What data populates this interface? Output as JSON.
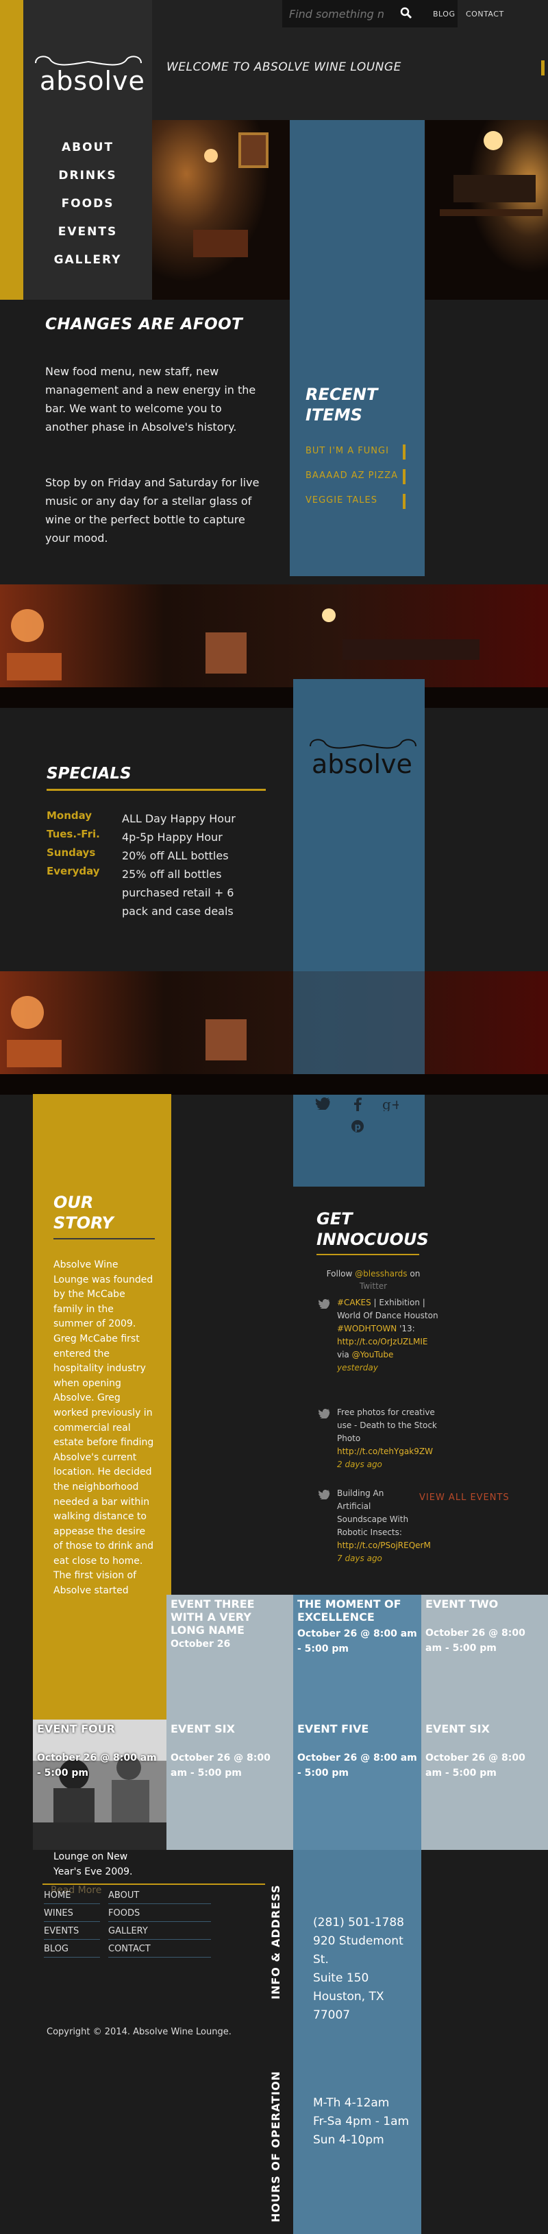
{
  "colors": {
    "gold": "#c49a14",
    "blue": "#3d6682",
    "dark": "#1c1c1c"
  },
  "header": {
    "search_placeholder": "Find something n",
    "search_icon": "search-icon",
    "blog_label": "BLOG",
    "contact_label": "CONTACT",
    "welcome": "WELCOME TO ABSOLVE WINE LOUNGE",
    "logo_text": "absolve"
  },
  "nav": {
    "items": [
      "ABOUT",
      "DRINKS",
      "FOODS",
      "EVENTS",
      "GALLERY"
    ]
  },
  "changes": {
    "title": "CHANGES ARE AFOOT",
    "p1": "New food menu, new staff, new management and a new energy in the bar. We want to welcome you to another phase in Absolve's history.",
    "p2": "Stop by on Friday and Saturday for live music or any day for a stellar glass of wine or the perfect bottle to capture your mood."
  },
  "recent": {
    "title_line1": "RECENT",
    "title_line2": "ITEMS",
    "items": [
      "BUT I'M A FUNGI",
      "BAAAAD AZ PIZZA",
      "VEGGIE TALES"
    ]
  },
  "specials": {
    "title": "SPECIALS",
    "rows": [
      {
        "day": "Monday",
        "deal": "ALL Day Happy Hour"
      },
      {
        "day": "Tues.-Fri.",
        "deal": "4p-5p Happy Hour"
      },
      {
        "day": "Sundays",
        "deal": "20% off ALL bottles"
      },
      {
        "day": "Everyday",
        "deal": "25% off all bottles purchased retail + 6 pack and case deals"
      }
    ]
  },
  "badge_logo": "absolve",
  "social": {
    "twitter_icon": "twitter-icon",
    "facebook_icon": "facebook-icon",
    "gplus_icon": "google-plus-icon",
    "pinterest_icon": "pinterest-icon"
  },
  "story": {
    "title_line1": "OUR",
    "title_line2": "STORY",
    "text": "Absolve Wine Lounge was founded by the McCabe family in the summer of 2009. Greg McCabe first entered the hospitality industry when opening Absolve. Greg worked previously in commercial real estate before finding Absolve's current location. He decided the neighborhood needed a bar within walking distance to appease the desire of those to drink and eat close to home. The first vision of Absolve started",
    "tail": "Lounge on New Year's Eve 2009.",
    "read_more": "Read More"
  },
  "innocuous": {
    "title_line1": "GET",
    "title_line2": "INNOCUOUS",
    "follow": "Follow",
    "handle": "@blesshards",
    "on": "on",
    "network": "Twitter",
    "tweets": [
      {
        "a": "#CAKES",
        "b": " | Exhibition | World Of Dance Houston ",
        "c": "#WODHTOWN",
        "d": " '13: ",
        "e": "http://t.co/OrJzUZLMIE",
        "f": " via ",
        "g": "@YouTube",
        "time": "yesterday"
      },
      {
        "a": "",
        "b": "Free photos for creative use - Death to the Stock Photo ",
        "c": "",
        "d": "",
        "e": "http://t.co/tehYgak9ZW",
        "f": "",
        "g": "",
        "time": "2 days ago"
      },
      {
        "a": "",
        "b": "Building An Artificial Soundscape With Robotic Insects: ",
        "c": "",
        "d": "",
        "e": "http://t.co/PSojREQerM",
        "f": "",
        "g": "",
        "time": "7 days ago"
      }
    ],
    "view_all": "VIEW ALL EVENTS"
  },
  "events": [
    {
      "title": "EVENT THREE WITH A VERY LONG NAME",
      "date": "October 26"
    },
    {
      "title": "THE MOMENT OF EXCELLENCE",
      "date": "October 26 @ 8:00 am - 5:00 pm"
    },
    {
      "title": "EVENT TWO",
      "date": "October 26 @ 8:00 am - 5:00 pm"
    },
    {
      "title": "EVENT FOUR",
      "date": "October 26 @ 8:00 am - 5:00 pm"
    },
    {
      "title": "EVENT SIX",
      "date": "October 26 @ 8:00 am - 5:00 pm"
    },
    {
      "title": "EVENT FIVE",
      "date": "October 26 @ 8:00 am - 5:00 pm"
    },
    {
      "title": "EVENT SIX",
      "date": "October 26 @ 8:00 am - 5:00 pm"
    }
  ],
  "footer": {
    "links": [
      "HOME",
      "ABOUT",
      "WINES",
      "FOODS",
      "EVENTS",
      "GALLERY",
      "BLOG",
      "CONTACT"
    ],
    "copyright": "Copyright © 2014. Absolve Wine Lounge.",
    "info_label": "INFO & ADDRESS",
    "phone": "(281) 501-1788",
    "address1": "920 Studemont",
    "address2": "St.",
    "address3": "Suite 150",
    "address4": "Houston, TX",
    "address5": "77007",
    "hours_label": "HOURS OF OPERATION",
    "hours": [
      "M-Th 4-12am",
      "Fr-Sa 4pm - 1am",
      "Sun 4-10pm"
    ]
  }
}
